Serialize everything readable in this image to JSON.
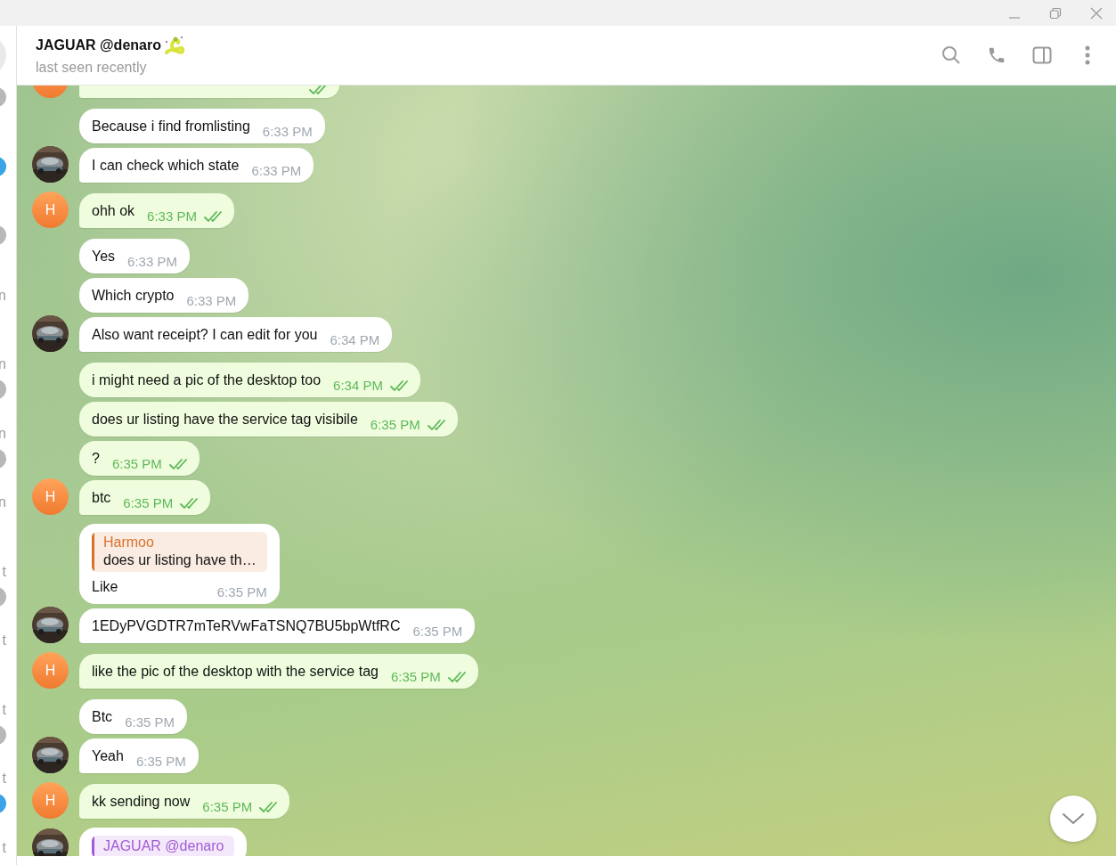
{
  "sidebar": {
    "items": [
      {
        "color": "#b8b8b8"
      },
      {
        "color": "#3ba4e6"
      },
      {
        "color": "#b8b8b8"
      },
      {
        "fragment": "n"
      },
      {
        "fragment": "n",
        "color": "#b8b8b8"
      },
      {
        "fragment": "n",
        "color": "#b8b8b8"
      },
      {
        "fragment": "n"
      },
      {
        "fragment": "t",
        "color": "#b8b8b8"
      },
      {
        "fragment": "t"
      },
      {
        "fragment": "t",
        "color": "#b8b8b8"
      },
      {
        "fragment": "t",
        "color": "#3ba4e6"
      },
      {
        "fragment": "t"
      }
    ]
  },
  "chat": {
    "title": "JAGUAR @denaro",
    "status": "last seen recently"
  },
  "messages": [
    {
      "kind": "out",
      "read": true,
      "avatar": true
    },
    {
      "kind": "in",
      "text": "Because i find fromlisting",
      "time": "6:33 PM",
      "avatar": false
    },
    {
      "kind": "in",
      "text": "I can check which state",
      "time": "6:33 PM",
      "avatar": true
    },
    {
      "kind": "out",
      "text": "ohh ok",
      "time": "6:33 PM",
      "read": true,
      "avatar": true,
      "initial": "H"
    },
    {
      "kind": "in",
      "text": "Yes",
      "time": "6:33 PM",
      "avatar": false
    },
    {
      "kind": "in",
      "text": "Which crypto",
      "time": "6:33 PM",
      "avatar": false
    },
    {
      "kind": "in",
      "text": "Also want receipt? I can edit for you",
      "time": "6:34 PM",
      "avatar": true
    },
    {
      "kind": "out",
      "text": "i might need a pic of the desktop too",
      "time": "6:34 PM",
      "read": true,
      "avatar": false
    },
    {
      "kind": "out",
      "text": "does ur listing have the service tag visibile",
      "time": "6:35 PM",
      "read": true,
      "avatar": false
    },
    {
      "kind": "out",
      "text": "?",
      "time": "6:35 PM",
      "read": true,
      "avatar": false
    },
    {
      "kind": "out",
      "text": "btc",
      "time": "6:35 PM",
      "read": true,
      "avatar": true,
      "initial": "H"
    },
    {
      "kind": "in",
      "reply": {
        "author": "Harmoo",
        "text": "does ur listing have th…",
        "color": "#d9712b"
      },
      "text": "Like",
      "time": "6:35 PM",
      "avatar": false
    },
    {
      "kind": "in",
      "text": "1EDyPVGDTR7mTeRVwFaTSNQ7BU5bpWtfRC",
      "time": "6:35 PM",
      "avatar": true
    },
    {
      "kind": "out",
      "text": "like the pic of the desktop with the service tag",
      "time": "6:35 PM",
      "read": true,
      "avatar": true,
      "initial": "H"
    },
    {
      "kind": "in",
      "text": "Btc",
      "time": "6:35 PM",
      "avatar": false
    },
    {
      "kind": "in",
      "text": "Yeah",
      "time": "6:35 PM",
      "avatar": true
    },
    {
      "kind": "out",
      "text": "kk sending now",
      "time": "6:35 PM",
      "read": true,
      "avatar": true,
      "initial": "H"
    },
    {
      "kind": "in",
      "reply": {
        "author": "JAGUAR @denaro",
        "color": "#a35ad6"
      },
      "avatar": true
    }
  ]
}
